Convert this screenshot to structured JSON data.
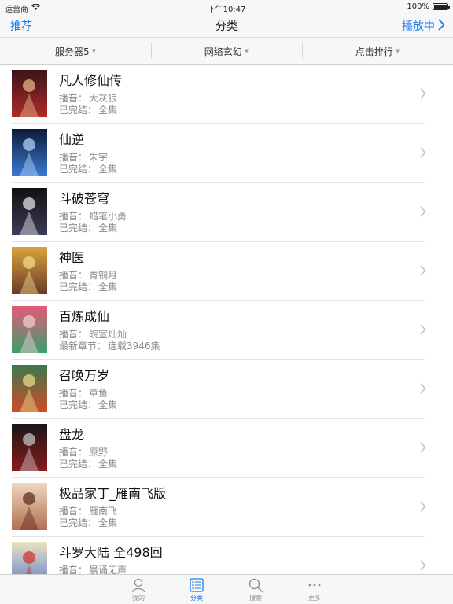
{
  "statusbar": {
    "carrier": "运营商",
    "time": "下午10:47",
    "battery": "100%"
  },
  "navbar": {
    "left": "推荐",
    "title": "分类",
    "right": "播放中"
  },
  "filters": [
    {
      "label": "服务器5"
    },
    {
      "label": "网络玄幻"
    },
    {
      "label": "点击排行"
    }
  ],
  "list": [
    {
      "title": "凡人修仙传",
      "narrator_label": "播音：",
      "narrator": "大灰狼",
      "status_label": "已完结：",
      "status": "全集"
    },
    {
      "title": "仙逆",
      "narrator_label": "播音：",
      "narrator": "朱宇",
      "status_label": "已完结：",
      "status": "全集"
    },
    {
      "title": "斗破苍穹",
      "narrator_label": "播音：",
      "narrator": "蜡笔小勇",
      "status_label": "已完结：",
      "status": "全集"
    },
    {
      "title": "神医",
      "narrator_label": "播音：",
      "narrator": "青铜月",
      "status_label": "已完结：",
      "status": "全集"
    },
    {
      "title": "百炼成仙",
      "narrator_label": "播音：",
      "narrator": "皖宣灿灿",
      "status_label": "最新章节：",
      "status": "连载3946集"
    },
    {
      "title": "召唤万岁",
      "narrator_label": "播音：",
      "narrator": "章鱼",
      "status_label": "已完结：",
      "status": "全集"
    },
    {
      "title": "盘龙",
      "narrator_label": "播音：",
      "narrator": "原野",
      "status_label": "已完结：",
      "status": "全集"
    },
    {
      "title": "极品家丁_雁南飞版",
      "narrator_label": "播音：",
      "narrator": "雁南飞",
      "status_label": "已完结：",
      "status": "全集"
    },
    {
      "title": "斗罗大陆 全498回",
      "narrator_label": "播音：",
      "narrator": "晨诵无声",
      "status_label": "",
      "status": ""
    }
  ],
  "covers": [
    {
      "top": "#3a1418",
      "bottom": "#b02a2a",
      "accent": "#e8c08a"
    },
    {
      "top": "#0c1a3a",
      "bottom": "#3a7bd0",
      "accent": "#b8d8ff"
    },
    {
      "top": "#111111",
      "bottom": "#3c3c58",
      "accent": "#eeeeee"
    },
    {
      "top": "#d9a43a",
      "bottom": "#6a3a2a",
      "accent": "#f5e08a"
    },
    {
      "top": "#e45a7a",
      "bottom": "#3aa06a",
      "accent": "#f5d0d8"
    },
    {
      "top": "#3a7a4a",
      "bottom": "#d04a2a",
      "accent": "#f0e08a"
    },
    {
      "top": "#181818",
      "bottom": "#8a1a1a",
      "accent": "#cccccc"
    },
    {
      "top": "#f0d8c0",
      "bottom": "#b07050",
      "accent": "#5a2a1a"
    },
    {
      "top": "#eae3c0",
      "bottom": "#5a7ad0",
      "accent": "#d0302a"
    }
  ],
  "tabs": [
    {
      "label": "我的",
      "icon": "person-icon",
      "active": false
    },
    {
      "label": "分类",
      "icon": "list-icon",
      "active": true
    },
    {
      "label": "搜索",
      "icon": "search-icon",
      "active": false
    },
    {
      "label": "更多",
      "icon": "more-icon",
      "active": false
    }
  ],
  "colors": {
    "accent": "#1a7ef0",
    "tab_inactive": "#8e8e8e"
  }
}
